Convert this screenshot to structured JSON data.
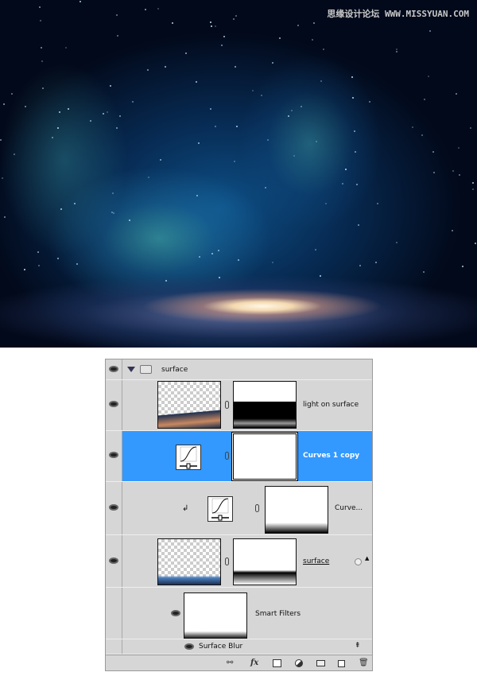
{
  "watermark": "思缘设计论坛 WWW.MISSYUAN.COM",
  "colors": {
    "selected": "#3399ff",
    "panel": "#d6d6d6"
  },
  "layers": {
    "group": {
      "name": "surface",
      "icon": "folder-icon",
      "expanded": true
    },
    "items": [
      {
        "name": "light on surface",
        "visible": true,
        "selected": false
      },
      {
        "name": "Curves 1 copy",
        "visible": true,
        "selected": true
      },
      {
        "name": "Curve...",
        "visible": true,
        "selected": false,
        "clipped": true
      },
      {
        "name": "surface",
        "visible": true,
        "selected": false,
        "smart_object": true
      },
      {
        "name": "Smart Filters",
        "visible": true
      },
      {
        "name": "Surface Blur",
        "visible": true
      }
    ]
  },
  "toolbar": [
    "link-icon",
    "fx-icon",
    "mask-icon",
    "adjustment-icon",
    "folder-icon",
    "new-layer-icon",
    "trash-icon"
  ],
  "toolbar_labels": {
    "fx": "fx"
  }
}
